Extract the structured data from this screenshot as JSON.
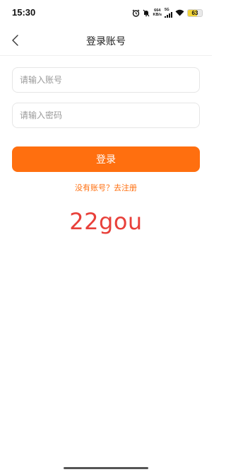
{
  "status_bar": {
    "time": "15:30",
    "net_speed_value": "664",
    "net_speed_unit": "KB/s",
    "signal_label": "5G",
    "battery_level": "63",
    "battery_fraction": 0.63,
    "icons": [
      "alarm-icon",
      "mute-icon",
      "signal-icon",
      "wifi-icon",
      "battery-icon"
    ]
  },
  "nav": {
    "title": "登录账号",
    "back_icon": "back-arrow-icon"
  },
  "form": {
    "account_placeholder": "请输入账号",
    "account_value": "",
    "password_placeholder": "请输入密码",
    "password_value": "",
    "login_label": "登录",
    "register_text": "没有账号？去注册"
  },
  "watermark_text": "22gou",
  "colors": {
    "accent": "#ff6f0f",
    "watermark": "#e8403a",
    "battery": "#f2d43a"
  }
}
